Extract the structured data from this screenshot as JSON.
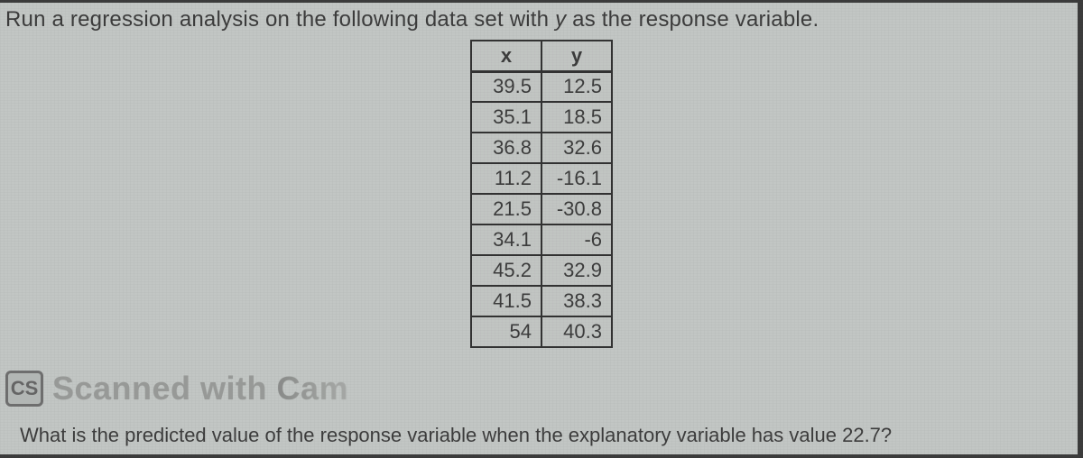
{
  "prompt": {
    "pre": "Run a regression analysis on the following data set with ",
    "var": "y",
    "post": " as the response variable."
  },
  "table": {
    "headers": {
      "x": "x",
      "y": "y"
    },
    "rows": [
      {
        "x": "39.5",
        "y": "12.5"
      },
      {
        "x": "35.1",
        "y": "18.5"
      },
      {
        "x": "36.8",
        "y": "32.6"
      },
      {
        "x": "11.2",
        "y": "-16.1"
      },
      {
        "x": "21.5",
        "y": "-30.8"
      },
      {
        "x": "34.1",
        "y": "-6"
      },
      {
        "x": "45.2",
        "y": "32.9"
      },
      {
        "x": "41.5",
        "y": "38.3"
      },
      {
        "x": "54",
        "y": "40.3"
      }
    ]
  },
  "watermark": {
    "badge": "CS",
    "text_main": "Scanned with ",
    "text_fade": "Cam"
  },
  "question": "What is the predicted value of the response variable when the explanatory variable has value 22.7?"
}
